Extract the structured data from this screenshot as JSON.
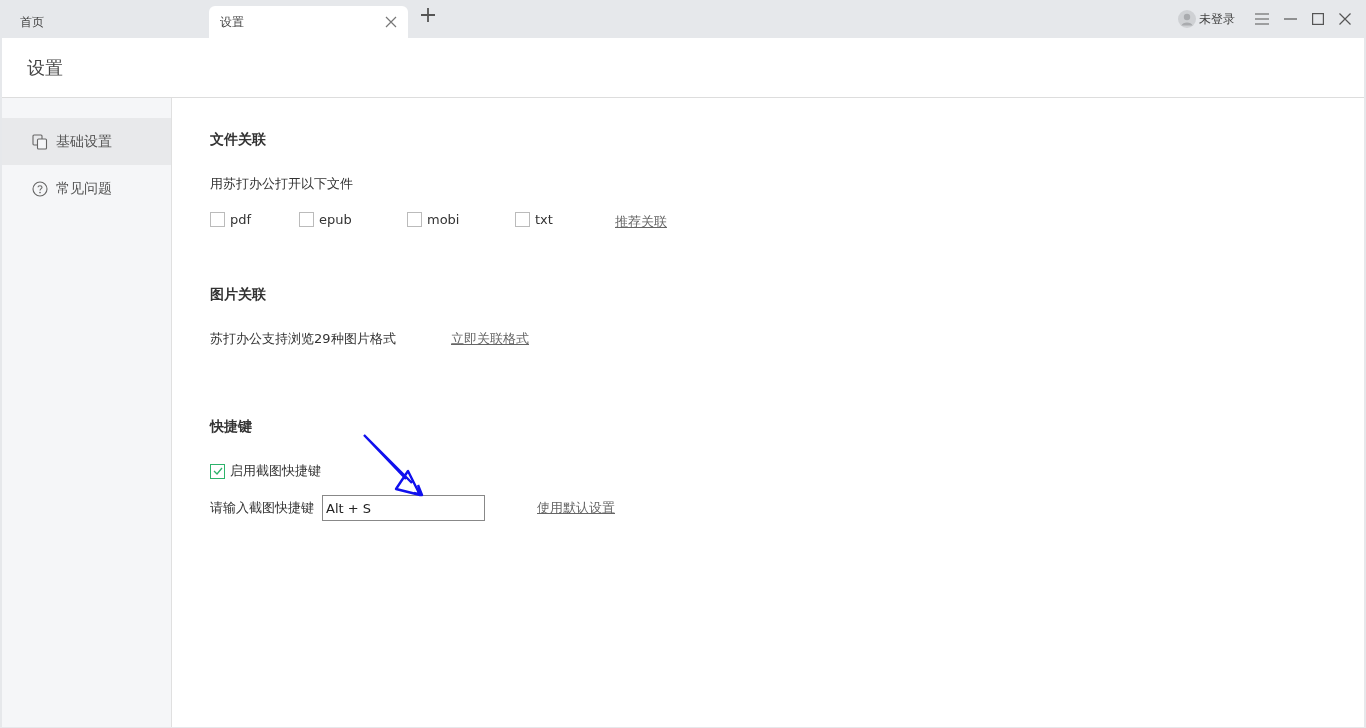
{
  "tabs": [
    {
      "label": "首页",
      "selected": false
    },
    {
      "label": "设置",
      "selected": true
    }
  ],
  "account": {
    "label": "未登录"
  },
  "page_title": "设置",
  "sidebar": {
    "items": [
      {
        "label": "基础设置",
        "selected": true
      },
      {
        "label": "常见问题",
        "selected": false
      }
    ]
  },
  "sections": [
    {
      "title": "文件关联",
      "kind": "files",
      "description": "用苏打办公打开以下文件",
      "options": [
        {
          "label": "pdf",
          "checked": false
        },
        {
          "label": "epub",
          "checked": false
        },
        {
          "label": "mobi",
          "checked": false
        },
        {
          "label": "txt",
          "checked": false
        }
      ],
      "link": "推荐关联"
    },
    {
      "title": "图片关联",
      "kind": "images",
      "description": "苏打办公支持浏览29种图片格式",
      "link": "立即关联格式"
    },
    {
      "title": "快捷键",
      "kind": "shortcut",
      "toggle": {
        "label": "启用截图快捷键",
        "checked": true
      },
      "field_label": "请输入截图快捷键",
      "value": "Alt + S",
      "link": "使用默认设置"
    }
  ]
}
